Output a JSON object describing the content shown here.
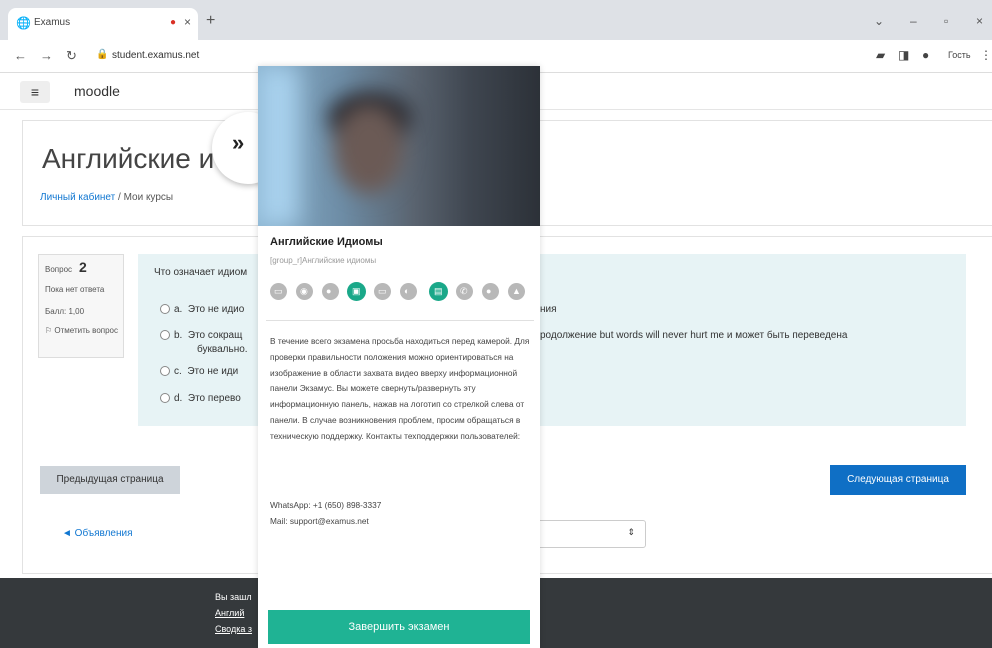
{
  "browser": {
    "tab_title": "Examus",
    "tab_icon": "globe-icon",
    "url": "student.examus.net",
    "profile_label": "Гость"
  },
  "moodle": {
    "brand": "moodle",
    "course_title": "Английские и",
    "breadcrumb": {
      "home": "Личный кабинет",
      "separator": "/",
      "current": "Мои курсы"
    }
  },
  "question": {
    "label": "Вопрос",
    "number": "2",
    "state": "Пока нет ответа",
    "mark": "Балл: 1,00",
    "flag": "Отметить вопрос",
    "prompt": "Что означает идиом",
    "options": [
      {
        "letter": "a.",
        "text": "Это не идио",
        "tail": "ния"
      },
      {
        "letter": "b.",
        "text": "Это сокращ",
        "tail": "родолжение but words will never hurt me и может быть переведена",
        "line2": "буквально."
      },
      {
        "letter": "c.",
        "text": "Это не иди",
        "tail": ""
      },
      {
        "letter": "d.",
        "text": "Это перево",
        "tail": ""
      }
    ]
  },
  "nav": {
    "prev": "Предыдущая страница",
    "next": "Следующая страница",
    "announcements": "◄ Объявления",
    "select_arrow": "⇕"
  },
  "footer": {
    "line1": "Вы зашл",
    "line2": "Англий",
    "line3": "Сводка з"
  },
  "proctor": {
    "title": "Английские Идиомы",
    "subtitle": "[group_r]Английские идиомы",
    "status_icons": [
      {
        "name": "screen-icon",
        "active": false
      },
      {
        "name": "camera-icon",
        "active": false
      },
      {
        "name": "mic-icon",
        "active": false
      },
      {
        "name": "browser-icon",
        "active": true
      },
      {
        "name": "display-icon",
        "active": false
      },
      {
        "name": "light-icon",
        "active": false
      },
      {
        "name": "id-card-icon",
        "active": true
      },
      {
        "name": "phone-icon",
        "active": false
      },
      {
        "name": "person-icon",
        "active": false
      },
      {
        "name": "lock-icon",
        "active": false
      }
    ],
    "instructions": "В течение всего экзамена просьба находиться перед камерой. Для проверки правильности положения можно ориентироваться на изображение в области захвата видео вверху информационной панели Экзамус. Вы можете свернуть/развернуть эту информационную панель, нажав на логотип со стрелкой слева от панели. В случае возникновения проблем, просим обращаться в техническую поддержку. Контакты техподдержки пользователей:",
    "whatsapp": "WhatsApp: +1 (650) 898-3337",
    "mail": "Mail: support@examus.net",
    "finish": "Завершить экзамен",
    "collapse_glyph": "»"
  }
}
